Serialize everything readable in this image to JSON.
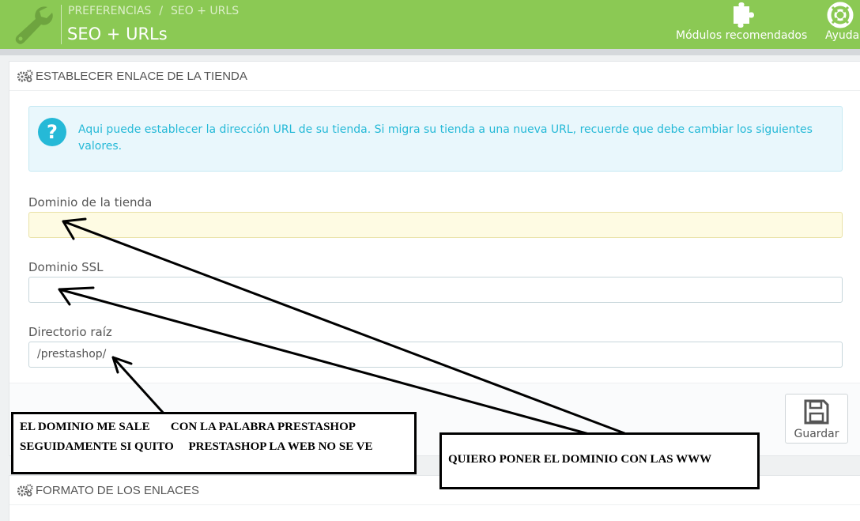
{
  "header": {
    "breadcrumb": [
      "PREFERENCIAS",
      "SEO + URLS"
    ],
    "breadcrumb_separator": "/",
    "title": "SEO + URLs",
    "toolbar": [
      {
        "label": "Módulos recomendados",
        "icon": "puzzle-icon"
      },
      {
        "label": "Ayuda",
        "icon": "lifebuoy-icon"
      }
    ],
    "colors": {
      "accent": "#8bc954"
    }
  },
  "shop_url_panel": {
    "heading": "ESTABLECER ENLACE DE LA TIENDA",
    "heading_icon": "cogs-icon",
    "alert": {
      "icon": "question-circle-icon",
      "text": "Aqui puede establecer la dirección URL de su tienda. Si migra su tienda a una nueva URL, recuerde que debe cambiar los siguientes valores."
    },
    "fields": [
      {
        "label": "Dominio de la tienda",
        "value": ""
      },
      {
        "label": "Dominio SSL",
        "value": ""
      },
      {
        "label": "Directorio raíz",
        "value": "/prestashop/"
      }
    ],
    "save_label": "Guardar",
    "save_icon": "save-icon"
  },
  "format_panel": {
    "heading": "FORMATO DE LOS ENLACES",
    "heading_icon": "cogs-icon"
  },
  "annotations": {
    "left_note": [
      "EL DOMINIO ME SALE       CON LA PALABRA PRESTASHOP",
      "SEGUIDAMENTE SI QUITO     PRESTASHOP LA WEB NO SE VE"
    ],
    "right_note": "QUIERO PONER EL DOMINIO CON LAS WWW"
  }
}
